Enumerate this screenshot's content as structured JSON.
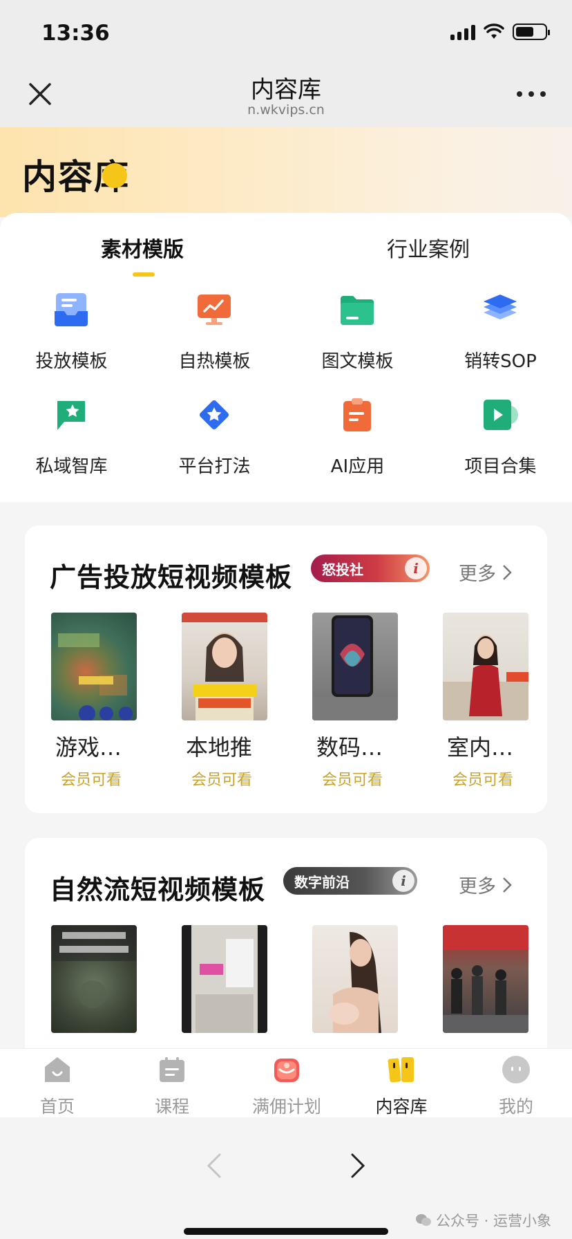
{
  "status_bar": {
    "time": "13:36"
  },
  "nav": {
    "title": "内容库",
    "url": "n.wkvips.cn"
  },
  "banner": {
    "title": "内容库"
  },
  "tabs": [
    {
      "label": "素材模版",
      "active": true
    },
    {
      "label": "行业案例",
      "active": false
    }
  ],
  "grid": [
    {
      "label": "投放模板",
      "icon": "tray-icon"
    },
    {
      "label": "自热模板",
      "icon": "trending-monitor-icon"
    },
    {
      "label": "图文模板",
      "icon": "folder-icon"
    },
    {
      "label": "销转SOP",
      "icon": "layers-icon"
    },
    {
      "label": "私域智库",
      "icon": "flag-star-icon"
    },
    {
      "label": "平台打法",
      "icon": "star-badge-icon"
    },
    {
      "label": "AI应用",
      "icon": "clipboard-icon"
    },
    {
      "label": "项目合集",
      "icon": "play-icon"
    }
  ],
  "section1": {
    "title": "广告投放短视频模板",
    "badge": "怒投社",
    "more": "更多",
    "items": [
      {
        "name": "游戏…",
        "tag": "会员可看"
      },
      {
        "name": "本地推",
        "tag": "会员可看"
      },
      {
        "name": "数码…",
        "tag": "会员可看"
      },
      {
        "name": "室内…",
        "tag": "会员可看"
      }
    ]
  },
  "section2": {
    "title": "自然流短视频模板",
    "badge": "数字前沿",
    "more": "更多"
  },
  "tabbar": [
    {
      "label": "首页",
      "icon": "home-icon",
      "active": false
    },
    {
      "label": "课程",
      "icon": "course-icon",
      "active": false
    },
    {
      "label": "满佣计划",
      "icon": "gift-icon",
      "active": false
    },
    {
      "label": "内容库",
      "icon": "library-icon",
      "active": true
    },
    {
      "label": "我的",
      "icon": "profile-icon",
      "active": false
    }
  ],
  "watermark": "公众号 · 运营小象",
  "colors": {
    "accent": "#f5c518",
    "member_tag": "#c9a227",
    "banner": "#fde3ad"
  }
}
